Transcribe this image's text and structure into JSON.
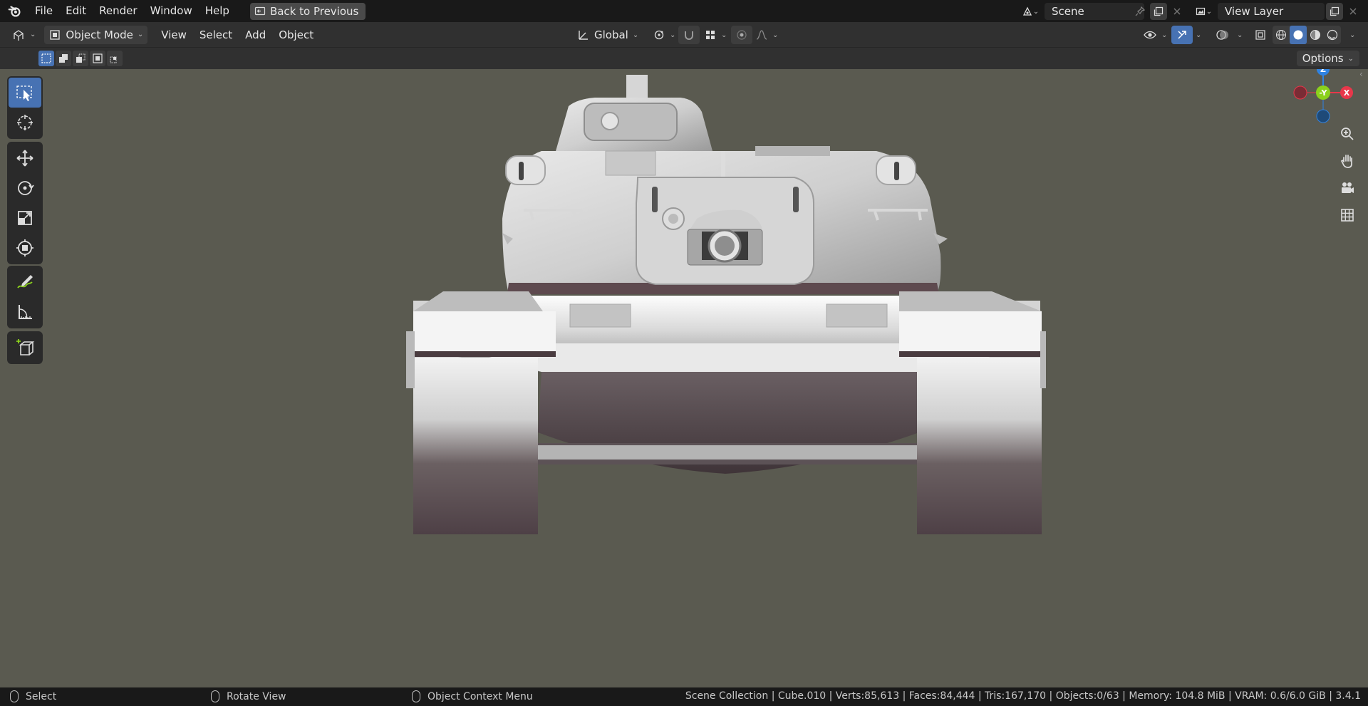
{
  "menu": {
    "items": [
      "File",
      "Edit",
      "Render",
      "Window",
      "Help"
    ],
    "back_button": "Back to Previous"
  },
  "scene": {
    "label": "Scene"
  },
  "view_layer": {
    "label": "View Layer"
  },
  "header": {
    "mode": "Object Mode",
    "menus": [
      "View",
      "Select",
      "Add",
      "Object"
    ],
    "orientation": "Global"
  },
  "tool_settings": {
    "options_label": "Options"
  },
  "tools": [
    {
      "name": "select-box-icon",
      "active": true
    },
    {
      "name": "cursor-icon",
      "active": false
    },
    {
      "name": "move-icon",
      "active": false
    },
    {
      "name": "rotate-icon",
      "active": false
    },
    {
      "name": "scale-icon",
      "active": false
    },
    {
      "name": "transform-icon",
      "active": false
    },
    {
      "name": "annotate-icon",
      "active": false
    },
    {
      "name": "measure-icon",
      "active": false
    },
    {
      "name": "add-cube-icon",
      "active": false
    }
  ],
  "gizmo": {
    "z": "Z",
    "y": "-Y",
    "x": "X"
  },
  "status": {
    "left": "Select",
    "middle": "Rotate View",
    "right": "Object Context Menu",
    "stats": "Scene Collection | Cube.010 | Verts:85,613 | Faces:84,444 | Tris:167,170 | Objects:0/63 | Memory: 104.8 MiB | VRAM: 0.6/6.0 GiB | 3.4.1"
  },
  "colors": {
    "viewport_bg": "#5a5a50",
    "accent": "#4772b3",
    "axis_x": "#e8374a",
    "axis_y": "#8bd11c",
    "axis_z": "#2f83e3"
  }
}
